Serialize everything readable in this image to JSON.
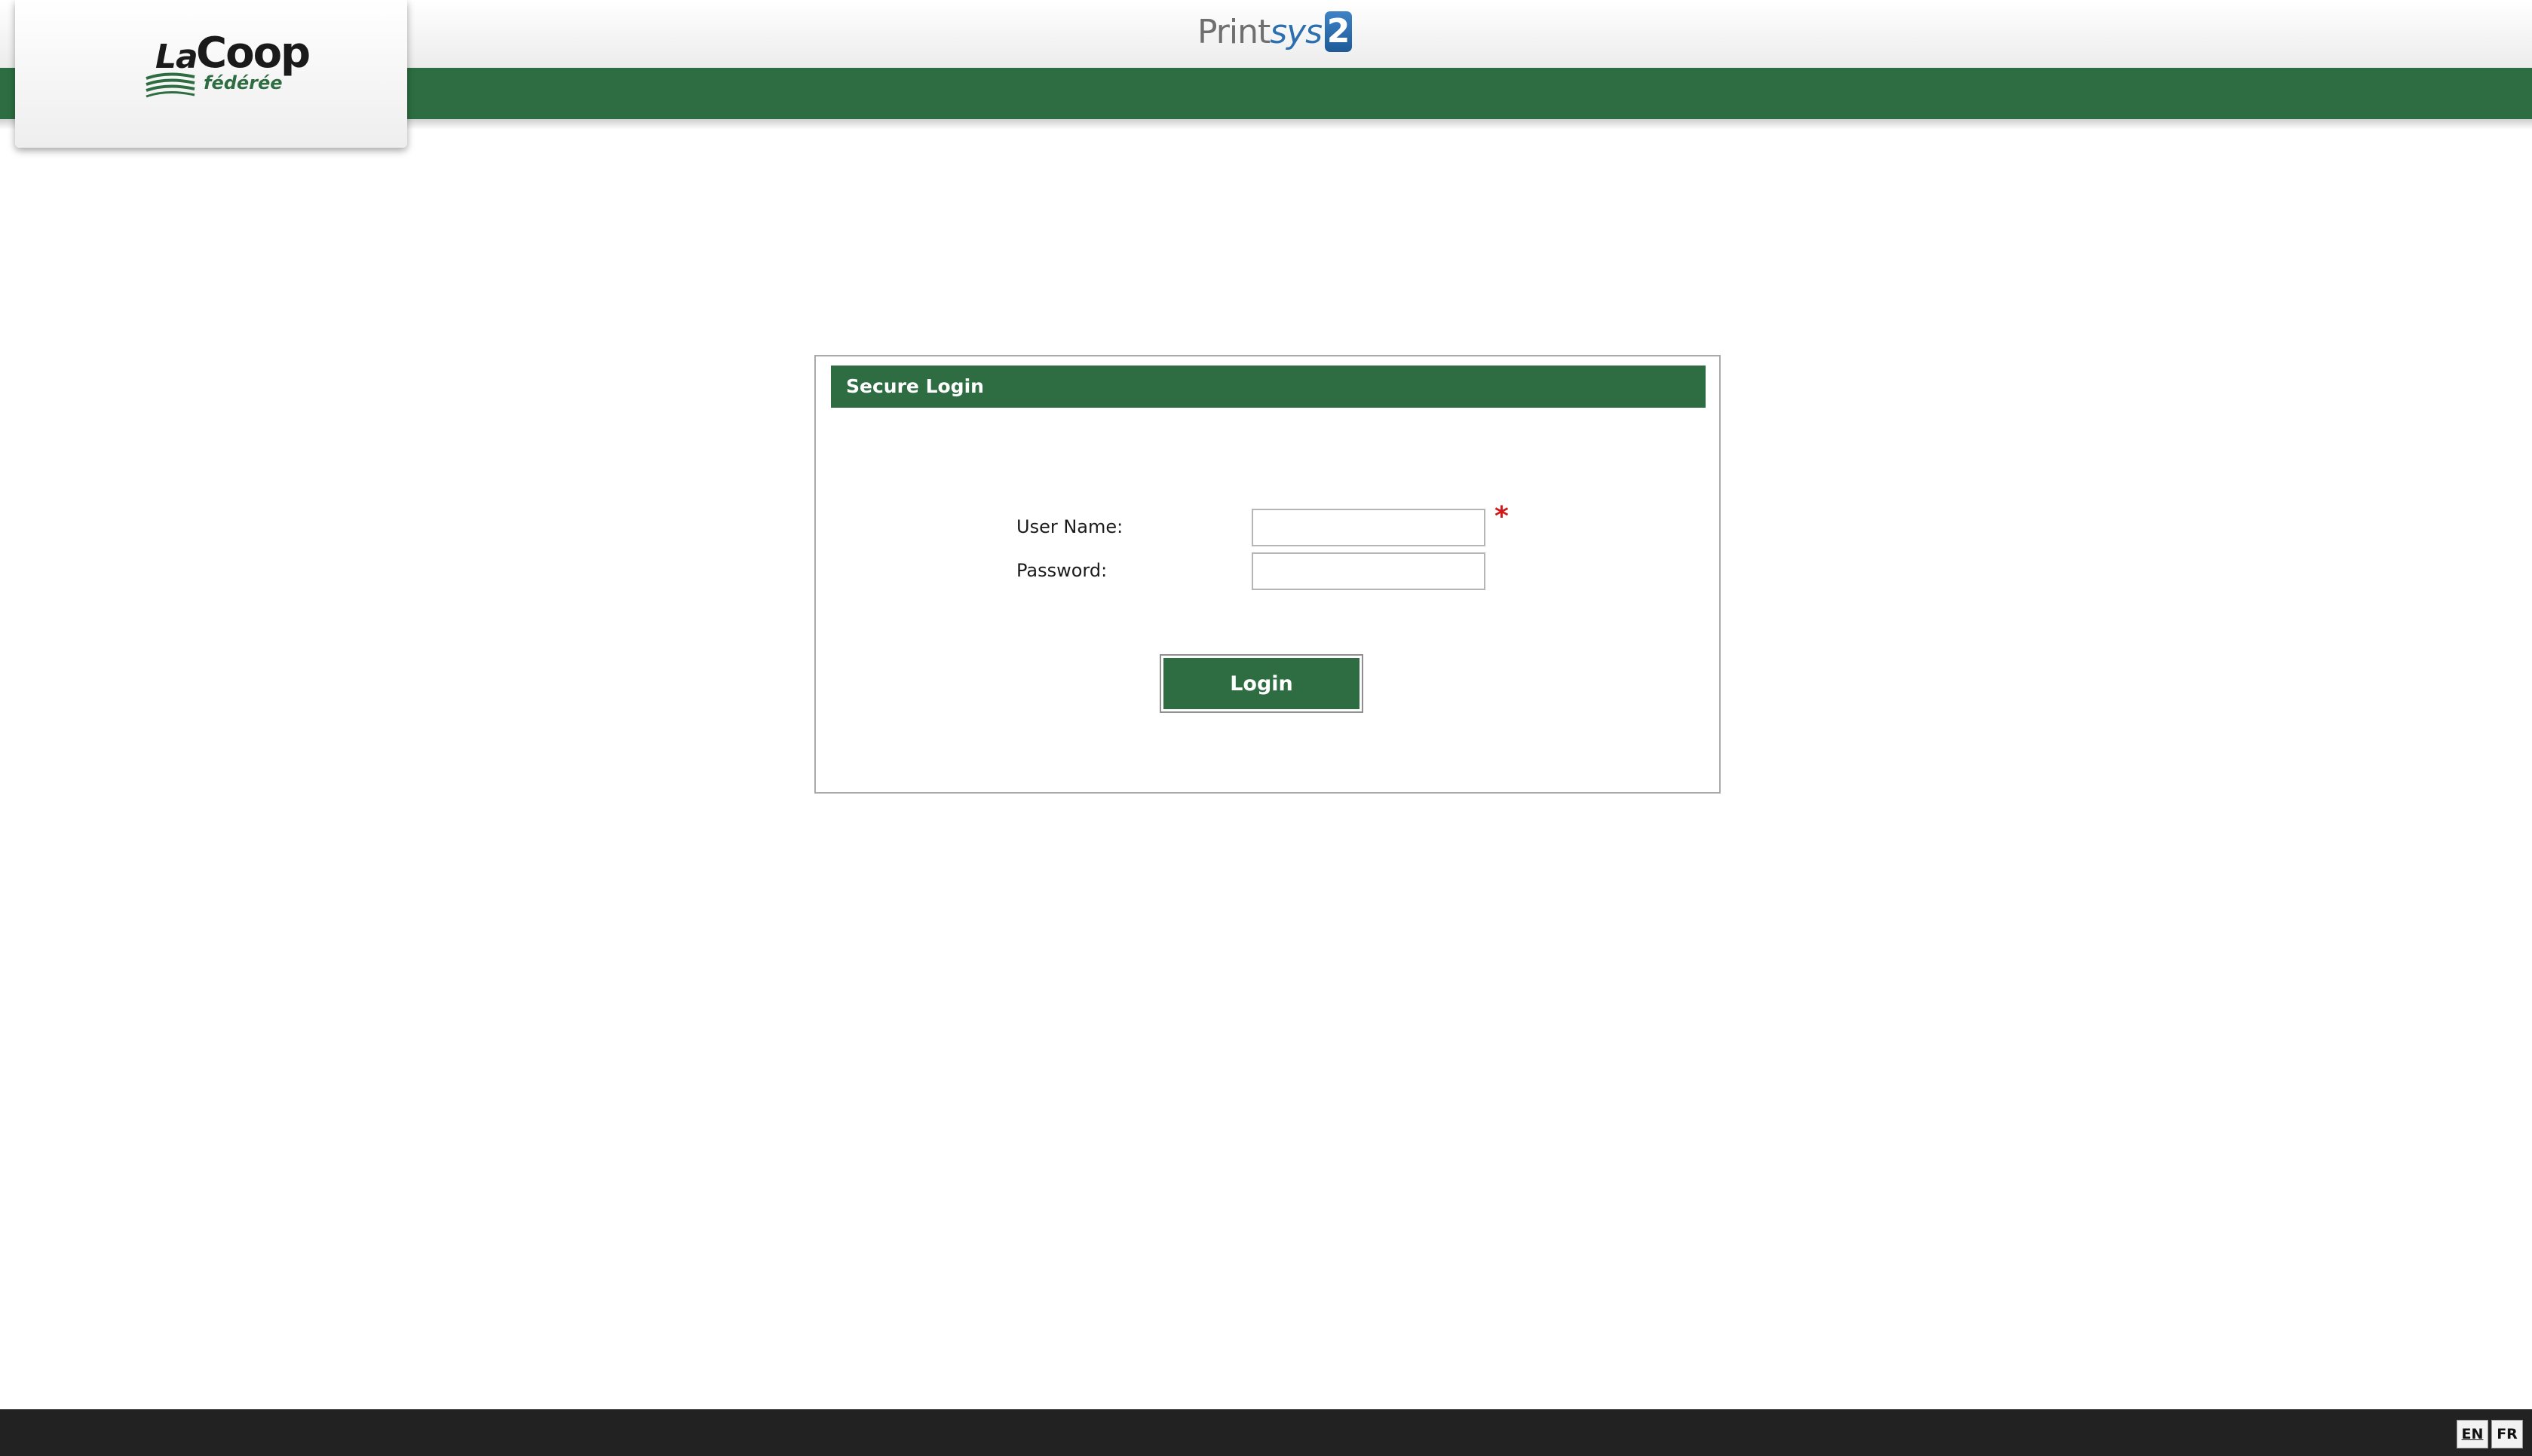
{
  "header": {
    "brand": {
      "name_prefix": "La",
      "name": "Coop",
      "subtitle": "fédérée"
    },
    "product": {
      "name_part1": "Print",
      "name_part2": "sys",
      "version": "2"
    }
  },
  "login": {
    "title": "Secure Login",
    "username_label": "User Name:",
    "username_value": "",
    "password_label": "Password:",
    "password_value": "",
    "required_marker": "*",
    "submit_label": "Login"
  },
  "footer": {
    "languages": [
      {
        "code": "EN",
        "active": true
      },
      {
        "code": "FR",
        "active": false
      }
    ]
  },
  "colors": {
    "brand_green": "#2e6d42",
    "required_red": "#d11919",
    "product_blue": "#2c6fae",
    "footer_dark": "#222222"
  }
}
